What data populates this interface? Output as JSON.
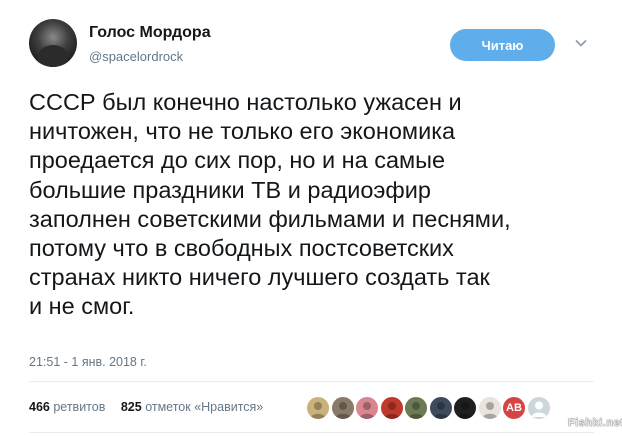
{
  "author": {
    "name": "Голос Мордора",
    "handle": "@spacelordrock"
  },
  "follow_button": {
    "label": "Читаю"
  },
  "tweet": {
    "lines": [
      "СССР был конечно настолько ужасен и",
      "ничтожен, что не только его экономика",
      "проедается до сих пор, но и на самые",
      "большие праздники ТВ и радиоэфир",
      "заполнен советскими фильмами и песнями,",
      "потому что в свободных постсоветских",
      "странах никто ничего лучшего создать так",
      "и не смог."
    ],
    "timestamp": "21:51 - 1 янв. 2018 г."
  },
  "stats": {
    "retweets_count": "466",
    "retweets_label": "ретвитов",
    "likes_count": "825",
    "likes_label": "отметок «Нравится»"
  },
  "likers": [
    {
      "icon": "avatar-icon",
      "color": "#c9b27a"
    },
    {
      "icon": "avatar-icon",
      "color": "#8a7a6a"
    },
    {
      "icon": "avatar-icon",
      "color": "#d9868f"
    },
    {
      "icon": "avatar-icon",
      "color": "#c0392b"
    },
    {
      "icon": "avatar-icon",
      "color": "#6d7b55"
    },
    {
      "icon": "avatar-icon",
      "color": "#3f4a5c"
    },
    {
      "icon": "avatar-icon",
      "color": "#1f1f1f"
    },
    {
      "icon": "avatar-icon",
      "color": "#e8e3dc"
    },
    {
      "icon": "avatar-icon",
      "color": "#d64545",
      "text": "AB"
    },
    {
      "icon": "default-avatar-icon",
      "color": "#ccd6dd"
    }
  ],
  "watermark": "Fishki.net",
  "colors": {
    "follow_button": "#5fadea",
    "secondary_text": "#657786",
    "divider": "#e6ecf0"
  }
}
